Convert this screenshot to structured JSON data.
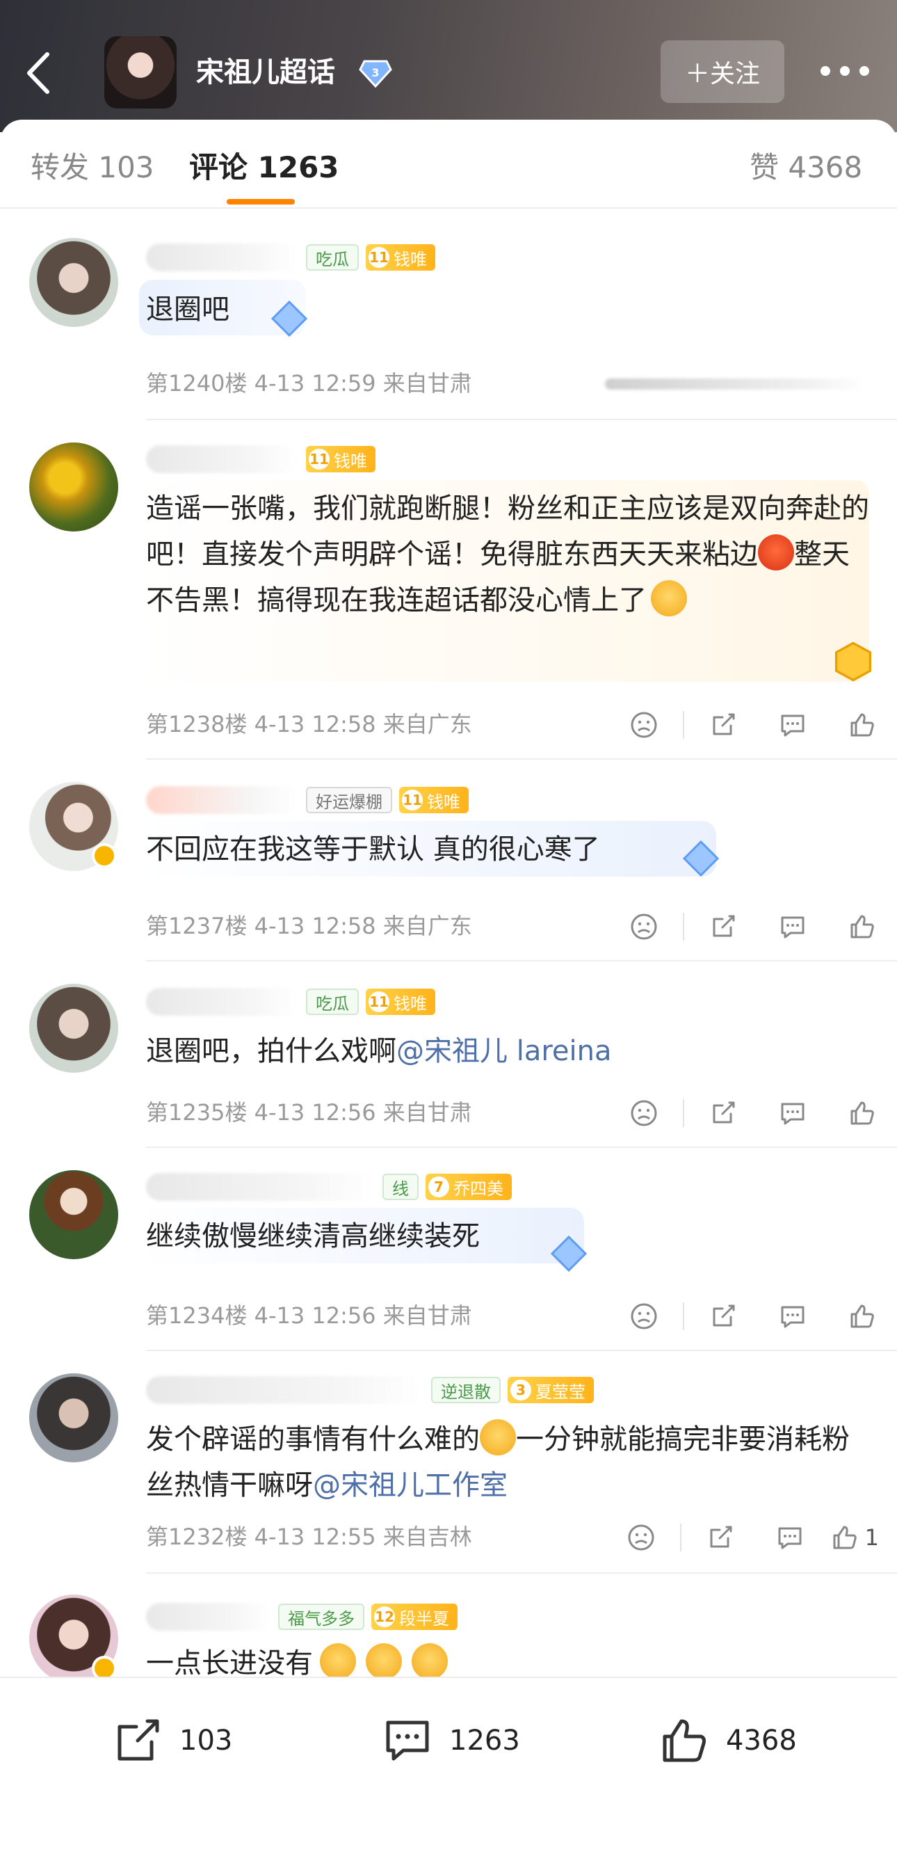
{
  "header": {
    "title": "宋祖儿超话",
    "follow_label": "＋关注"
  },
  "tabs": {
    "repost": "转发 103",
    "comments": "评论 1263",
    "likes": "赞 4368"
  },
  "comments": [
    {
      "fan_tag": "吃瓜",
      "level": "11",
      "level_name": "钱唯",
      "text": "退圈吧",
      "meta": "第1240楼 4-13 12:59 来自甘肃"
    },
    {
      "level": "11",
      "level_name": "钱唯",
      "text": "造谣一张嘴，我们就跑断腿！粉丝和正主应该是双向奔赴的吧！直接发个声明辟个谣！免得脏东西天天来粘边",
      "text2": "整天不告黑！搞得现在我连超话都没心情上了",
      "meta": "第1238楼 4-13 12:58 来自广东"
    },
    {
      "fan_tag": "好运爆棚",
      "level": "11",
      "level_name": "钱唯",
      "text": "不回应在我这等于默认 真的很心寒了",
      "meta": "第1237楼 4-13 12:58 来自广东"
    },
    {
      "fan_tag": "吃瓜",
      "level": "11",
      "level_name": "钱唯",
      "text": "退圈吧，拍什么戏啊",
      "mention": "@宋祖儿 lareina",
      "meta": "第1235楼 4-13 12:56 来自甘肃"
    },
    {
      "fan_tag": "线",
      "level": "7",
      "level_name": "乔四美",
      "text": "继续傲慢继续清高继续装死",
      "meta": "第1234楼 4-13 12:56 来自甘肃"
    },
    {
      "fan_tag": "逆退散",
      "level": "3",
      "level_name": "夏莹莹",
      "text": "发个辟谣的事情有什么难的",
      "text2": "一分钟就能搞完非要消耗粉丝热情干嘛呀",
      "mention": "@宋祖儿工作室",
      "meta": "第1232楼 4-13 12:55 来自吉林",
      "like_count": "1"
    },
    {
      "fan_tag": "福气多多",
      "level": "12",
      "level_name": "段半夏",
      "text": "一点长进没有"
    }
  ],
  "bottom_bar": {
    "repost_count": "103",
    "comment_count": "1263",
    "like_count": "4368"
  },
  "colors": {
    "accent": "#ff8200",
    "mention": "#4f6fa8",
    "level_tag": "#ffb31a"
  }
}
